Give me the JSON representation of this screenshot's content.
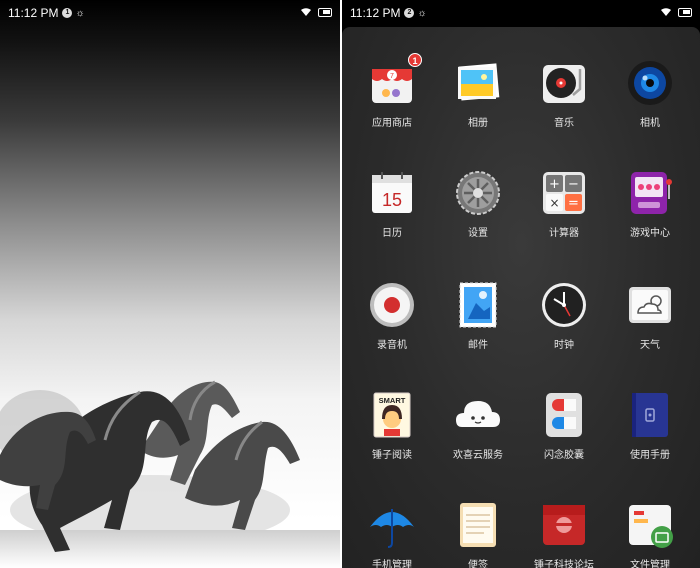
{
  "status_left": {
    "time": "11:12 PM",
    "notif_count": "1"
  },
  "status_right": {
    "time": "11:12 PM",
    "notif_count": "2"
  },
  "apps": [
    {
      "label": "应用商店",
      "icon": "app-store-icon",
      "badge": "1"
    },
    {
      "label": "相册",
      "icon": "gallery-icon"
    },
    {
      "label": "音乐",
      "icon": "music-icon"
    },
    {
      "label": "相机",
      "icon": "camera-icon"
    },
    {
      "label": "日历",
      "icon": "calendar-icon",
      "icon_text": "15"
    },
    {
      "label": "设置",
      "icon": "settings-gear-icon"
    },
    {
      "label": "计算器",
      "icon": "calculator-icon"
    },
    {
      "label": "游戏中心",
      "icon": "game-center-icon"
    },
    {
      "label": "录音机",
      "icon": "recorder-icon"
    },
    {
      "label": "邮件",
      "icon": "mail-stamp-icon"
    },
    {
      "label": "时钟",
      "icon": "clock-icon"
    },
    {
      "label": "天气",
      "icon": "weather-icon"
    },
    {
      "label": "锤子阅读",
      "icon": "reader-icon",
      "icon_text": "SMART"
    },
    {
      "label": "欢喜云服务",
      "icon": "cloud-icon"
    },
    {
      "label": "闪念胶囊",
      "icon": "capsule-icon"
    },
    {
      "label": "使用手册",
      "icon": "manual-icon"
    },
    {
      "label": "手机管理",
      "icon": "umbrella-icon"
    },
    {
      "label": "便签",
      "icon": "notes-icon"
    },
    {
      "label": "锤子科技论坛",
      "icon": "forum-icon"
    },
    {
      "label": "文件管理",
      "icon": "file-manager-icon"
    }
  ]
}
